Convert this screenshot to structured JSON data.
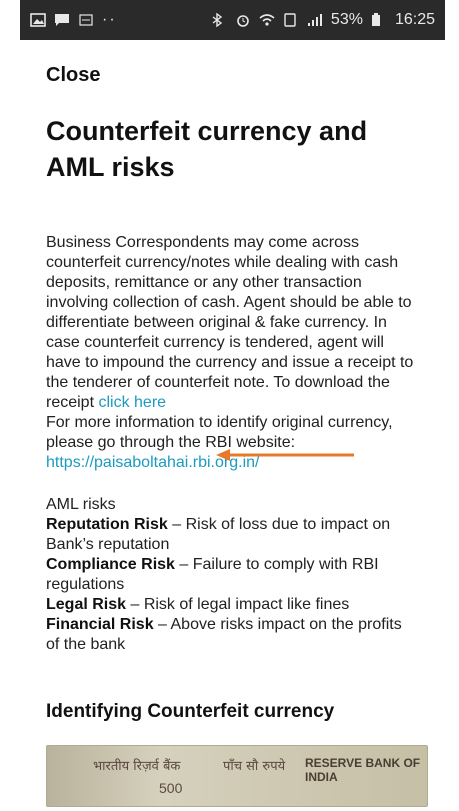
{
  "status_bar": {
    "battery": "53%",
    "time": "16:25",
    "icons": [
      "image-icon",
      "message-icon",
      "sim-icon",
      "bluetooth-icon",
      "alarm-icon",
      "wifi-icon",
      "nfc-icon",
      "signal-icon",
      "battery-icon"
    ]
  },
  "close_label": "Close",
  "title": "Counterfeit currency and AML risks",
  "paragraph": {
    "text": "Business Correspondents may come across counterfeit currency/notes while dealing with cash deposits, remittance or any other transaction involving collection of cash. Agent should be able to differentiate between original & fake currency. In case counterfeit currency is tendered, agent will have to impound the currency and issue a receipt to the tenderer of counterfeit note. To download the receipt ",
    "link_text": "click here",
    "more_text": "For more information to identify original currency, please go through the RBI website:",
    "url": "https://paisaboltahai.rbi.org.in/"
  },
  "aml": {
    "heading": "AML risks",
    "risks": [
      {
        "name": "Reputation Risk",
        "desc": " – Risk of loss due to impact on Bank’s reputation"
      },
      {
        "name": "Compliance Risk",
        "desc": " – Failure to comply with RBI regulations"
      },
      {
        "name": "Legal Risk",
        "desc": " – Risk of legal impact like fines"
      },
      {
        "name": "Financial Risk",
        "desc": " – Above risks impact on the profits of the bank"
      }
    ]
  },
  "section_heading": "Identifying Counterfeit currency",
  "banknote": {
    "hindi_bank": "भारतीय रिज़र्व बैंक",
    "hindi_amount": "पाँच सौ रुपये",
    "english_bank": "RESERVE BANK OF INDIA",
    "number": "500"
  },
  "colors": {
    "link": "#1a9bbf",
    "arrow": "#e8792a",
    "status_bar": "#2a2a2a"
  }
}
